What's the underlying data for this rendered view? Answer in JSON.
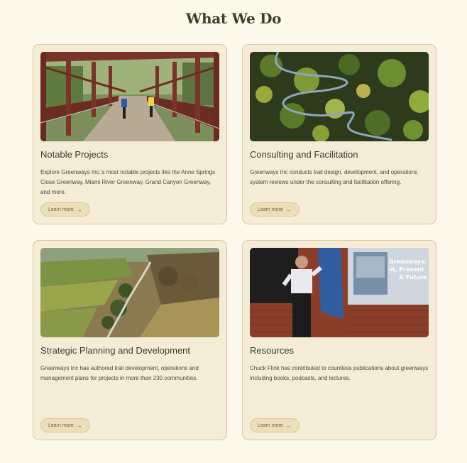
{
  "section": {
    "title": "What We Do"
  },
  "cards": [
    {
      "title": "Notable Projects",
      "description": "Explore Greenways Inc.'s most notable projects like the Anne Springs Close Greenway, Miami River Greenway, Grand Canyon Greenway, and more.",
      "button_label": "Learn more",
      "button_icon": "arrow-right-icon",
      "image": "bridge-cyclists-photo"
    },
    {
      "title": "Consulting and Facilitation",
      "description": "Greenways Inc conducts trail design, development, and operations system reviews under the consulting and facilitation offering.",
      "button_label": "Learn more",
      "button_icon": "arrow-right-icon",
      "image": "winding-trail-aerial-photo"
    },
    {
      "title": "Strategic Planning and Development",
      "description": "Greenways Inc has authored trail development, operations and management plans for projects in more than 230 communities.",
      "button_label": "Learn more",
      "button_icon": "arrow-right-icon",
      "image": "greenway-countryside-aerial-photo"
    },
    {
      "title": "Resources",
      "description": "Chuck Flink has contributed to countless publications about greenways including books, podcasts, and lectures.",
      "button_label": "Learn more",
      "button_icon": "arrow-right-icon",
      "image": "speaker-lecture-photo",
      "image_text": [
        "Greenways:",
        "st, Present",
        "& Future"
      ]
    }
  ],
  "colors": {
    "page_bg": "#fcf8ec",
    "card_bg": "#f5ecd8",
    "card_border": "#d8c89c",
    "heading": "#3d4226",
    "button_bg": "#ebdeb8"
  }
}
